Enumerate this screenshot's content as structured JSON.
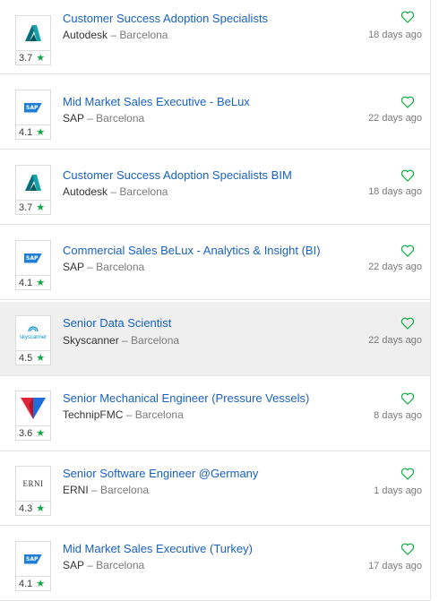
{
  "jobs": [
    {
      "title": "Customer Success Adoption Specialists",
      "company": "Autodesk",
      "location": "Barcelona",
      "age": "18 days ago",
      "rating": "3.7",
      "logo": "autodesk-logo"
    },
    {
      "title": "Mid Market Sales Executive - BeLux",
      "company": "SAP",
      "location": "Barcelona",
      "age": "22 days ago",
      "rating": "4.1",
      "logo": "sap-logo"
    },
    {
      "title": "Customer Success Adoption Specialists BIM",
      "company": "Autodesk",
      "location": "Barcelona",
      "age": "18 days ago",
      "rating": "3.7",
      "logo": "autodesk-logo"
    },
    {
      "title": "Commercial Sales BeLux - Analytics & Insight (BI)",
      "company": "SAP",
      "location": "Barcelona",
      "age": "22 days ago",
      "rating": "4.1",
      "logo": "sap-logo"
    },
    {
      "title": "Senior Data Scientist",
      "company": "Skyscanner",
      "location": "Barcelona",
      "age": "22 days ago",
      "rating": "4.5",
      "logo": "skyscanner-logo"
    },
    {
      "title": "Senior Mechanical Engineer (Pressure Vessels)",
      "company": "TechnipFMC",
      "location": "Barcelona",
      "age": "8 days ago",
      "rating": "3.6",
      "logo": "technipfmc-logo"
    },
    {
      "title": "Senior Software Engineer @Germany",
      "company": "ERNI",
      "location": "Barcelona",
      "age": "1 days ago",
      "rating": "4.3",
      "logo": "erni-logo"
    },
    {
      "title": "Mid Market Sales Executive (Turkey)",
      "company": "SAP",
      "location": "Barcelona",
      "age": "17 days ago",
      "rating": "4.1",
      "logo": "sap-logo"
    }
  ],
  "separator": " – ",
  "star": "★",
  "logo_text": {
    "sap": "SAP",
    "erni": "ERNI",
    "skyscanner": "skyscanner"
  },
  "colors": {
    "title": "#1861bf",
    "star": "#0caa41",
    "heart": "#0caa41",
    "active_bg": "#efefef"
  }
}
